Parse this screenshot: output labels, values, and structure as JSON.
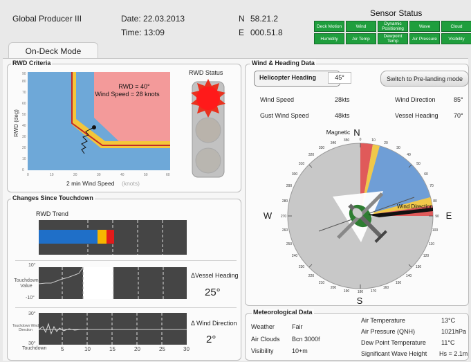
{
  "header": {
    "vessel": "Global Producer III",
    "date": "Date: 22.03.2013",
    "time": "Time: 13:09",
    "north_label": "N",
    "north_value": "58.21.2",
    "east_label": "E",
    "east_value": "000.51.8"
  },
  "sensor_status": {
    "title": "Sensor Status",
    "items": [
      "Deck Motion",
      "Wind",
      "Dynamic Positioning",
      "Wave",
      "Cloud",
      "Humidity",
      "Air Temp",
      "Dewpoint Temp",
      "Air Pressure",
      "Visibility"
    ],
    "status_color": "#1f9e3d"
  },
  "tabs": {
    "active": "On-Deck Mode"
  },
  "rwd_criteria": {
    "title": "RWD Criteria",
    "status_label": "RWD Status",
    "annotation_rwd": "RWD = 40°",
    "annotation_wind": "Wind Speed = 28 knots",
    "ylabel": "RWD (deg)",
    "xlabel": "2 min Wind Speed",
    "xlabel_unit": "(knots)",
    "x_ticks": [
      "0",
      "10",
      "20",
      "30",
      "40",
      "50",
      "60"
    ],
    "y_ticks": [
      "0",
      "10",
      "20",
      "30",
      "40",
      "50",
      "60",
      "70",
      "80",
      "90"
    ],
    "point": {
      "wind": 28,
      "rwd": 40
    },
    "traffic_light": "red"
  },
  "changes": {
    "title": "Changes Since Touchdown",
    "trend_label": "RWD Trend",
    "vessel_heading_label": "ΔVessel Heading",
    "vessel_heading_value": "25°",
    "wind_direction_label": "Δ Wind Direction",
    "wind_direction_value": "2°",
    "vh_top": "10°",
    "vh_mid": "Touchdown Value",
    "vh_bottom": "-10°",
    "wd_top": "30°",
    "wd_mid": "Touchdown Wind Direction",
    "wd_bottom": "30°",
    "x_ticks": [
      "Touchdown",
      "5",
      "10",
      "15",
      "20",
      "25",
      "30"
    ]
  },
  "wind_heading": {
    "title": "Wind & Heading Data",
    "heli_heading_label": "Helicopter Heading",
    "heli_heading_value": "45°",
    "switch_button": "Switch to Pre-landing mode",
    "wind_speed_label": "Wind Speed",
    "wind_speed_value": "28kts",
    "gust_label": "Gust Wind Speed",
    "gust_value": "48kts",
    "wind_dir_label": "Wind Direction",
    "wind_dir_value": "85°",
    "vessel_heading_label": "Vessel Heading",
    "vessel_heading_value": "70°",
    "compass": {
      "magnetic_label": "Magnetic",
      "N": "N",
      "E": "E",
      "S": "S",
      "W": "W",
      "wind_direction_arrow_label": "Wind Direction",
      "wind_direction_deg": 85,
      "vessel_heading_deg": 70,
      "heli_heading_deg": 45
    }
  },
  "meteorological": {
    "title": "Meteorological Data",
    "weather_label": "Weather",
    "weather_value": "Fair",
    "clouds_label": "Air Clouds",
    "clouds_value": "Bcn 3000f",
    "visibility_label": "Visibility",
    "visibility_value": "10+m",
    "air_temp_label": "Air Temperature",
    "air_temp_value": "13°C",
    "pressure_label": "Air Pressure (QNH)",
    "pressure_value": "1021hPa",
    "dewpoint_label": "Dew Point Temperature",
    "dewpoint_value": "11°C",
    "wave_label": "Significant Wave Height",
    "wave_value": "Hs = 2.1m"
  }
}
